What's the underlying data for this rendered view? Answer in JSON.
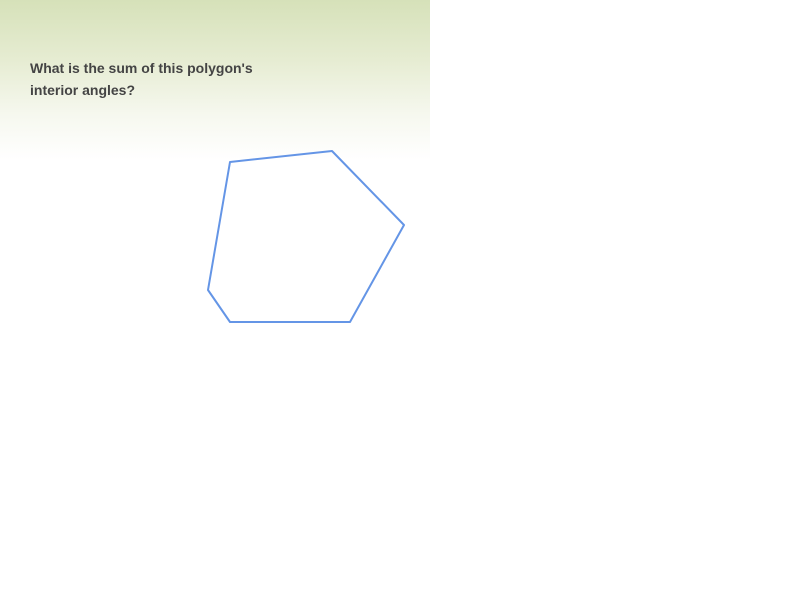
{
  "question": {
    "text": "What is the sum of this polygon's interior angles?"
  },
  "diagram": {
    "shape": "polygon",
    "vertex_count": 6,
    "stroke_color": "#6495e6",
    "fill": "none"
  }
}
